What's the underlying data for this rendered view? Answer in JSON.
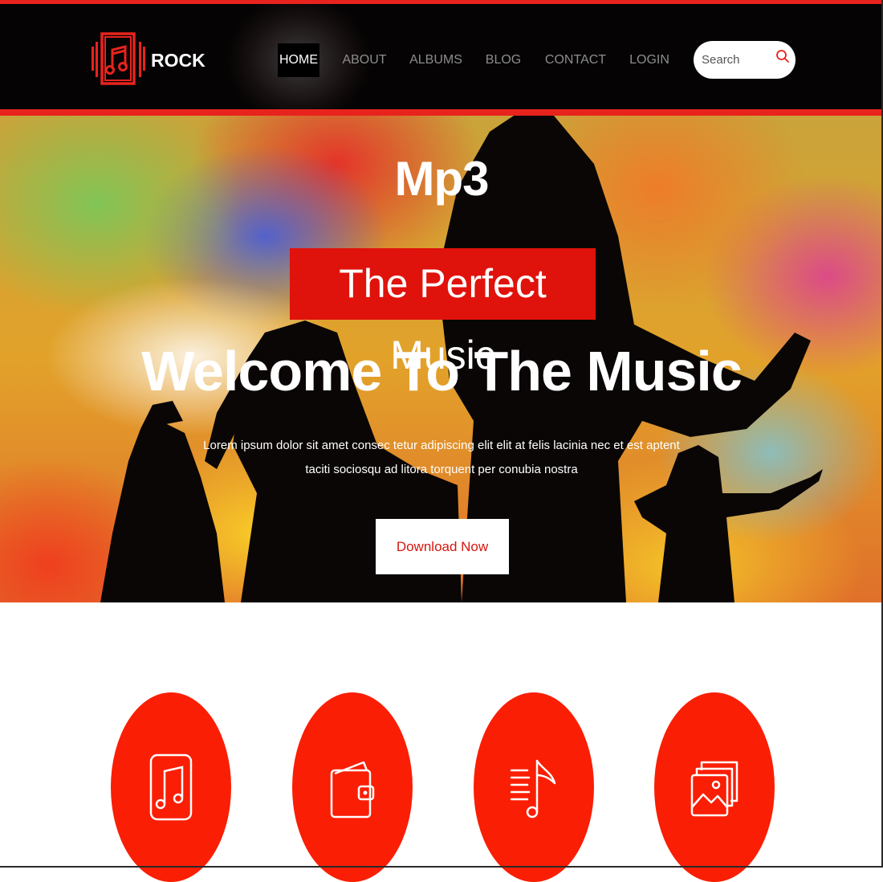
{
  "brand": {
    "name": "ROCK",
    "logo_icon": "music-note-icon",
    "accent": "#e8231d"
  },
  "nav": {
    "items": [
      {
        "label": "HOME",
        "active": true
      },
      {
        "label": "ABOUT",
        "active": false
      },
      {
        "label": "ALBUMS",
        "active": false
      },
      {
        "label": "BLOG",
        "active": false
      },
      {
        "label": "CONTACT",
        "active": false
      },
      {
        "label": "LOGIN",
        "active": false
      }
    ]
  },
  "search": {
    "placeholder": "Search",
    "value": "",
    "icon": "search-icon"
  },
  "hero": {
    "title": "Mp3",
    "badge": "The Perfect Music",
    "heading": "Welcome To The Music",
    "subtitle": "Lorem ipsum dolor sit amet consec tetur adipiscing elit elit at felis lacinia nec et est aptent taciti sociosqu ad litora torquent per conubia nostra",
    "button_label": "Download Now"
  },
  "features": {
    "color": "#fa1e04",
    "items": [
      {
        "icon": "music-file-icon"
      },
      {
        "icon": "wallet-icon"
      },
      {
        "icon": "playlist-icon"
      },
      {
        "icon": "gallery-icon"
      }
    ]
  }
}
